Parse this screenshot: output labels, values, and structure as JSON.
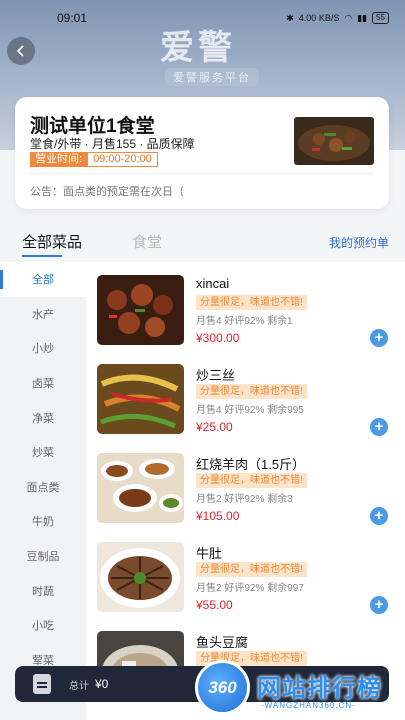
{
  "status_bar": {
    "time": "09:01",
    "network_speed": "4.00 KB/S",
    "battery": "55"
  },
  "header": {
    "brand": "爱警",
    "brand_subtitle": "爱警服务平台"
  },
  "store": {
    "name": "测试单位1食堂",
    "meta": "堂食/外带 · 月售155 · 品质保障",
    "hours_label": "营业时间:",
    "hours_value": "09:00-20:00",
    "notice": "公告：面点类的预定需在次日（"
  },
  "tabs": {
    "all": "全部菜品",
    "canteen": "食堂",
    "my_booking": "我的预约单"
  },
  "categories": [
    "全部",
    "水产",
    "小炒",
    "卤菜",
    "净菜",
    "炒菜",
    "面点类",
    "牛奶",
    "豆制品",
    "时蔬",
    "小吃",
    "荤菜",
    "..."
  ],
  "dishes": [
    {
      "name": "xincai",
      "tag": "分量很足，味道也不错!",
      "stats": "月售4 好评92% 剩余1",
      "price": "¥300.00"
    },
    {
      "name": "炒三丝",
      "tag": "分量很足，味道也不错!",
      "stats": "月售4 好评92% 剩余995",
      "price": "¥25.00"
    },
    {
      "name": "红烧羊肉（1.5斤）",
      "tag": "分量很足，味道也不错!",
      "stats": "月售2 好评92% 剩余3",
      "price": "¥105.00"
    },
    {
      "name": "牛肚",
      "tag": "分量很足，味道也不错!",
      "stats": "月售2 好评92% 剩余997",
      "price": "¥55.00"
    },
    {
      "name": "鱼头豆腐",
      "tag": "分量很足，味道也不错!",
      "stats": "",
      "price": ""
    }
  ],
  "cart": {
    "total_label": "总计",
    "total": "¥0"
  },
  "watermark": {
    "badge": "360",
    "text": "网站排行榜",
    "sub": "-WANGZHAN360.CN-"
  },
  "colors": {
    "accent": "#2f7bd9",
    "price": "#d9262c",
    "tag_bg": "#fde3c8",
    "hours": "#f08a3c",
    "cart_bar": "#202738"
  }
}
